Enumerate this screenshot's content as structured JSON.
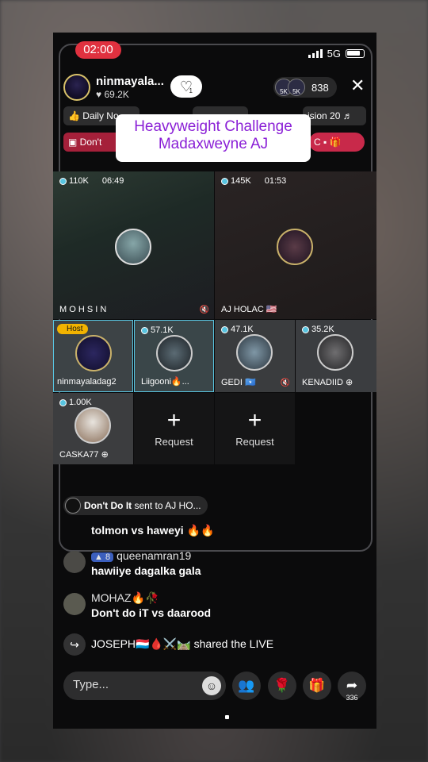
{
  "status": {
    "time": "02:00",
    "network": "5G"
  },
  "host": {
    "name": "ninmayala...",
    "likes": "69.2K",
    "heart_count": "1",
    "viewer_count": "838",
    "mini_viewers": [
      "5K",
      "5K"
    ]
  },
  "tags": {
    "daily": "Daily No",
    "session": "ision 20",
    "dont": "Don't",
    "c": "C"
  },
  "overlay": {
    "line1": "Heavyweight Challenge",
    "line2": "Madaxweyne AJ"
  },
  "tiles": {
    "t1": {
      "viewers": "110K",
      "time": "06:49",
      "name": "M O H S I N"
    },
    "t2": {
      "viewers": "145K",
      "time": "01:53",
      "name": "AJ HOLAC 🇺🇸"
    },
    "t3": {
      "host_label": "Host",
      "name": "ninmayaladag2"
    },
    "t4": {
      "viewers": "57.1K",
      "name": "Liigooni🔥..."
    },
    "t5": {
      "viewers": "47.1K",
      "name": "GEDI 🇸🇴"
    },
    "t6": {
      "viewers": "35.2K",
      "name": "KENADIID"
    },
    "t7": {
      "viewers": "1.00K",
      "name": "CASKA77"
    },
    "r1": {
      "label": "Request"
    },
    "r2": {
      "label": "Request"
    }
  },
  "gift_line": {
    "gift": "Don't Do It",
    "text": " sent to AJ HO..."
  },
  "comments": [
    {
      "user": "",
      "text": "tolmon vs haweyi 🔥🔥"
    },
    {
      "level": "8",
      "user": "queenamran19",
      "text": "hawiiye dagalka gala"
    },
    {
      "user": "MOHAZ🔥🥀",
      "text": "Don't do iT vs daarood"
    }
  ],
  "share": {
    "text": "JOSEPH🇱🇺🩸⚔️🛤️ shared the LIVE"
  },
  "input": {
    "placeholder": "Type..."
  },
  "share_count": "336",
  "colors": {
    "accent": "#e0313f",
    "overlay_text": "#8a1fd6",
    "live_blue": "#58c4e0"
  }
}
